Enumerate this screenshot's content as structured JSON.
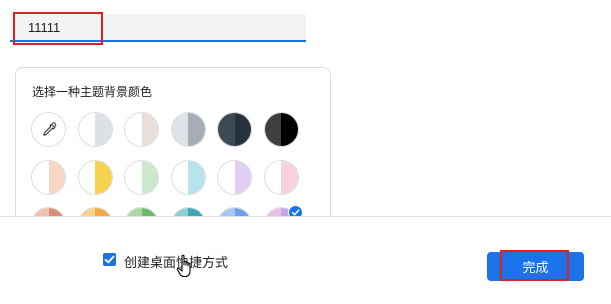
{
  "profile_name": {
    "value": "11111"
  },
  "theme_colors": {
    "title": "选择一种主题背景颜色",
    "swatches": [
      {
        "name": "color-picker",
        "left": "#ffffff",
        "right": "#ffffff",
        "icon": "eyedropper-icon",
        "selected": false
      },
      {
        "name": "grey-light",
        "left": "#ffffff",
        "right": "#dde1e6",
        "selected": false
      },
      {
        "name": "beige",
        "left": "#ffffff",
        "right": "#eaded8",
        "selected": false
      },
      {
        "name": "grey-mid",
        "left": "#dfe2e7",
        "right": "#a7adb6",
        "selected": false
      },
      {
        "name": "slate-dark",
        "left": "#3c4a55",
        "right": "#28323a",
        "selected": false
      },
      {
        "name": "black",
        "left": "#3c4043",
        "right": "#000000",
        "selected": false
      },
      {
        "name": "peach",
        "left": "#ffffff",
        "right": "#f7d6c4",
        "selected": false
      },
      {
        "name": "yellow",
        "left": "#ffffff",
        "right": "#f6d34c",
        "selected": false
      },
      {
        "name": "green-light",
        "left": "#ffffff",
        "right": "#cce7c9",
        "selected": false
      },
      {
        "name": "cyan-light",
        "left": "#ffffff",
        "right": "#b6e3ec",
        "selected": false
      },
      {
        "name": "lavender",
        "left": "#ffffff",
        "right": "#e0cff2",
        "selected": false
      },
      {
        "name": "pink-light",
        "left": "#ffffff",
        "right": "#f7d2e0",
        "selected": false
      },
      {
        "name": "coral",
        "left": "#f3c1b0",
        "right": "#d98f7a",
        "selected": false
      },
      {
        "name": "orange",
        "left": "#fbd28f",
        "right": "#f5a742",
        "selected": false
      },
      {
        "name": "green",
        "left": "#a9d8a4",
        "right": "#6cbd6a",
        "selected": false
      },
      {
        "name": "teal",
        "left": "#8ccfd4",
        "right": "#3fa9b3",
        "selected": false
      },
      {
        "name": "blue",
        "left": "#a7c7f1",
        "right": "#6ea2e6",
        "selected": false
      },
      {
        "name": "pink",
        "left": "#e9c1e6",
        "right": "#c8a4ea",
        "selected": true
      }
    ]
  },
  "shortcut": {
    "label": "创建桌面快捷方式",
    "checked": true
  },
  "done_button": {
    "label": "完成"
  },
  "colors": {
    "accent": "#1a73e8",
    "highlight": "#e02020"
  }
}
